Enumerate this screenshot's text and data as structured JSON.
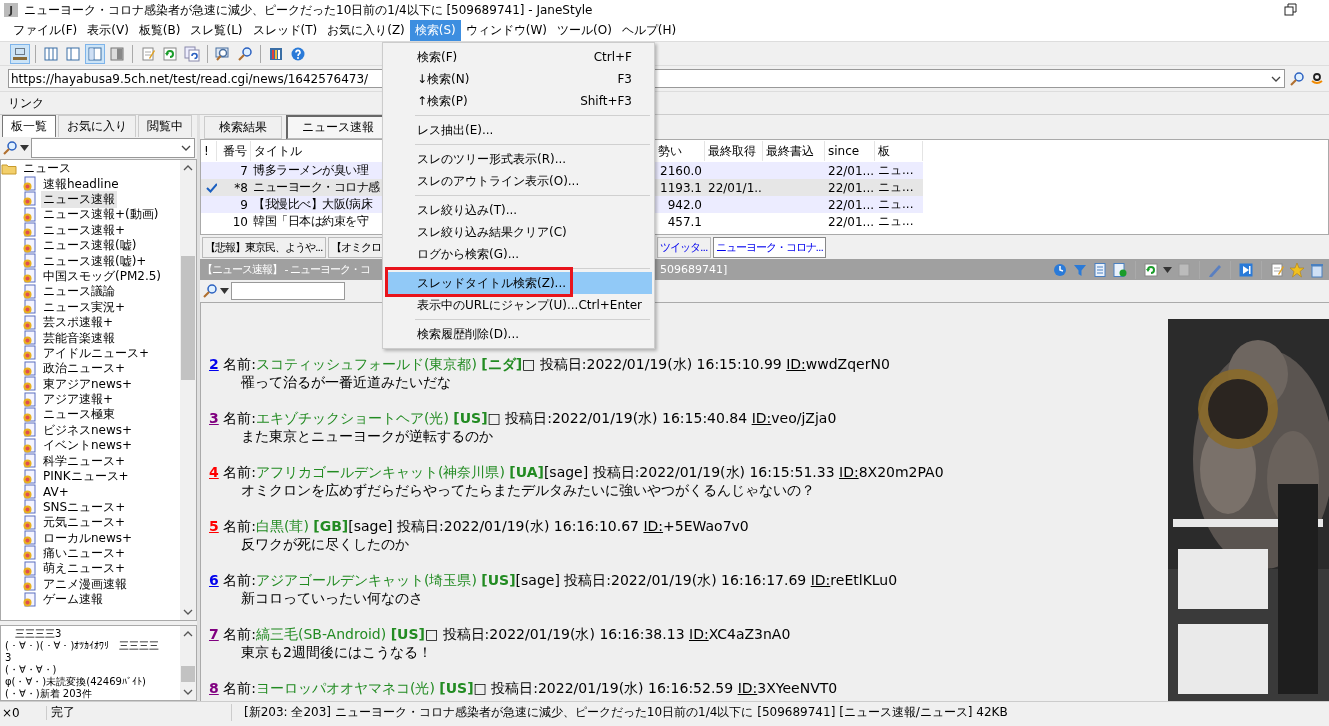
{
  "window": {
    "icon_letter": "J",
    "title": "ニューヨーク・コロナ感染者が急速に減少、ピークだった10日前の1/4以下に [509689741] - JaneStyle"
  },
  "menu_bar": [
    {
      "label": "ファイル(F)",
      "selected": false
    },
    {
      "label": "表示(V)",
      "selected": false
    },
    {
      "label": "板覧(B)",
      "selected": false
    },
    {
      "label": "スレ覧(L)",
      "selected": false
    },
    {
      "label": "スレッド(T)",
      "selected": false
    },
    {
      "label": "お気に入り(Z)",
      "selected": false
    },
    {
      "label": "検索(S)",
      "selected": true
    },
    {
      "label": "ウィンドウ(W)",
      "selected": false
    },
    {
      "label": "ツール(O)",
      "selected": false
    },
    {
      "label": "ヘルプ(H)",
      "selected": false
    }
  ],
  "toolbar": [
    {
      "kind": "network",
      "pressed": true
    },
    {
      "kind": "separator"
    },
    {
      "kind": "columns",
      "pressed": false
    },
    {
      "kind": "pane-left",
      "pressed": false
    },
    {
      "kind": "pane-right",
      "pressed": true
    },
    {
      "kind": "pane-gray",
      "pressed": false
    },
    {
      "kind": "separator"
    },
    {
      "kind": "notepad",
      "pressed": false
    },
    {
      "kind": "refresh",
      "pressed": false
    },
    {
      "kind": "refresh-all",
      "pressed": false
    },
    {
      "kind": "separator"
    },
    {
      "kind": "magnifier-page",
      "pressed": false
    },
    {
      "kind": "search",
      "pressed": false
    },
    {
      "kind": "separator"
    },
    {
      "kind": "tools",
      "pressed": false
    },
    {
      "kind": "help",
      "pressed": false
    }
  ],
  "address_bar": {
    "value": "https://hayabusa9.5ch.net/test/read.cgi/news/1642576473/"
  },
  "link_bar": {
    "label": "リンク"
  },
  "left_pane": {
    "tabs": [
      {
        "label": "板一覧",
        "selected": true
      },
      {
        "label": "お気に入り",
        "selected": false
      },
      {
        "label": "閲覧中",
        "selected": false
      }
    ],
    "tree": [
      {
        "label": "ニュース",
        "expanded": true,
        "children": [
          {
            "label": "速報headline",
            "selected": false
          },
          {
            "label": "ニュース速報",
            "selected": true
          },
          {
            "label": "ニュース速報+(動画)",
            "selected": false
          },
          {
            "label": "ニュース速報+",
            "selected": false
          },
          {
            "label": "ニュース速報(嘘)",
            "selected": false
          },
          {
            "label": "ニュース速報(嘘)+",
            "selected": false
          },
          {
            "label": "中国スモッグ(PM2.5)",
            "selected": false
          },
          {
            "label": "ニュース議論",
            "selected": false
          },
          {
            "label": "ニュース実況+",
            "selected": false
          },
          {
            "label": "芸スポ速報+",
            "selected": false
          },
          {
            "label": "芸能音楽速報",
            "selected": false
          },
          {
            "label": "アイドルニュース+",
            "selected": false
          },
          {
            "label": "政治ニュース+",
            "selected": false
          },
          {
            "label": "東アジアnews+",
            "selected": false
          },
          {
            "label": "アジア速報+",
            "selected": false
          },
          {
            "label": "ニュース極東",
            "selected": false
          },
          {
            "label": "ビジネスnews+",
            "selected": false
          },
          {
            "label": "イベントnews+",
            "selected": false
          },
          {
            "label": "科学ニュース+",
            "selected": false
          },
          {
            "label": "PINKニュース+",
            "selected": false
          },
          {
            "label": "AV+",
            "selected": false
          },
          {
            "label": "SNSニュース+",
            "selected": false
          },
          {
            "label": "元気ニュース+",
            "selected": false
          },
          {
            "label": "ローカルnews+",
            "selected": false
          },
          {
            "label": "痛いニュース+",
            "selected": false
          },
          {
            "label": "萌えニュース+",
            "selected": false
          },
          {
            "label": "アニメ漫画速報",
            "selected": false
          },
          {
            "label": "ゲーム速報",
            "selected": false
          }
        ]
      }
    ],
    "log": [
      "　三三三三3",
      "(・∀・)(・∀・)ｵﾂｶｲｵﾜﾘ　三三三三",
      "3",
      "(・∀・∀・)",
      "φ(・∀・)未読変換(42469ﾊﾞｲﾄ)",
      "(・∀・)新着 203件"
    ]
  },
  "right_pane": {
    "tabs": [
      {
        "label": "検索結果",
        "selected": false
      },
      {
        "label": "ニュース速報",
        "selected": true
      }
    ],
    "thread_list": {
      "columns": [
        "!",
        "番号",
        "タイトル",
        "勢い",
        "最終取得",
        "最終書込",
        "since",
        "板"
      ],
      "rows": [
        {
          "marked": false,
          "selected": false,
          "number": "7",
          "title": "博多ラーメンが臭い理",
          "momentum": "2160.0",
          "since": "22/01...",
          "board": "ニュ..."
        },
        {
          "marked": true,
          "selected": true,
          "number": "*8",
          "title": "ニューヨーク・コロナ感",
          "momentum": "1193.1",
          "last_fetched": "22/01/1...",
          "since": "22/01...",
          "board": "ニュ..."
        },
        {
          "marked": false,
          "selected": false,
          "number": "9",
          "title": "【我慢比べ】大阪(病床",
          "momentum": "942.0",
          "since": "22/01...",
          "board": "ニュ..."
        },
        {
          "marked": false,
          "selected": false,
          "number": "10",
          "title": "韓国「日本は約束を守",
          "momentum": "457.1",
          "since": "22/01...",
          "board": "ニュ..."
        }
      ]
    },
    "thread_tabs": [
      {
        "label": "【悲報】東京民、ようや...",
        "selected": false,
        "unread": false
      },
      {
        "label": "【オミクロ",
        "selected": false,
        "unread": false
      },
      {
        "label": "ツイッタ...",
        "selected": false,
        "unread": true
      },
      {
        "label": "ニューヨーク・コロナ...",
        "selected": true,
        "unread": true
      }
    ],
    "thread_header": {
      "board_part": "【ニュース速報】 - ニューヨーク・コ",
      "id_part": "509689741]"
    },
    "thread_toolbar": [
      {
        "kind": "clock"
      },
      {
        "kind": "filter"
      },
      {
        "kind": "page"
      },
      {
        "kind": "page-refresh"
      },
      {
        "kind": "separator"
      },
      {
        "kind": "refresh"
      },
      {
        "kind": "caret"
      },
      {
        "kind": "stop"
      },
      {
        "kind": "separator"
      },
      {
        "kind": "pen"
      },
      {
        "kind": "separator"
      },
      {
        "kind": "jump"
      },
      {
        "kind": "separator"
      },
      {
        "kind": "notepad"
      },
      {
        "kind": "star"
      },
      {
        "kind": "trash"
      }
    ],
    "posts": [
      {
        "number": "2",
        "color": "#0000ee",
        "name_label": "名前:",
        "name": "スコティッシュフォールド(東京都)",
        "tag": "[ニダ]",
        "mail": "□",
        "date": "投稿日:2022/01/19(水) 16:15:10.99",
        "id_label": "ID:",
        "id": "wwdZqerN0",
        "body": "罹って治るが一番近道みたいだな"
      },
      {
        "number": "3",
        "color": "#800080",
        "name_label": "名前:",
        "name": "エキゾチックショートヘア(光)",
        "tag": "[US]",
        "mail": "□",
        "date": "投稿日:2022/01/19(水) 16:15:40.84",
        "id_label": "ID:",
        "id": "veo/jZja0",
        "body": "また東京とニューヨークが逆転するのか"
      },
      {
        "number": "4",
        "color": "#ff0000",
        "name_label": "名前:",
        "name": "アフリカゴールデンキャット(神奈川県)",
        "tag": "[UA]",
        "mail": "[sage]",
        "date": "投稿日:2022/01/19(水) 16:15:51.33",
        "id_label": "ID:",
        "id": "8X20m2PA0",
        "body": "オミクロンを広めずだらだらやってたらまたデルタみたいに強いやつがくるんじゃないの？"
      },
      {
        "number": "5",
        "color": "#ff0000",
        "name_label": "名前:",
        "name": "白黒(茸)",
        "tag": "[GB]",
        "mail": "[sage]",
        "date": "投稿日:2022/01/19(水) 16:16:10.67",
        "id_label": "ID:",
        "id": "+5EWao7v0",
        "body": "反ワクが死に尽くしたのか"
      },
      {
        "number": "6",
        "color": "#0000ee",
        "name_label": "名前:",
        "name": "アジアゴールデンキャット(埼玉県)",
        "tag": "[US]",
        "mail": "[sage]",
        "date": "投稿日:2022/01/19(水) 16:16:17.69",
        "id_label": "ID:",
        "id": "reEtlKLu0",
        "body": "新コロっていったい何なのさ"
      },
      {
        "number": "7",
        "color": "#800080",
        "name_label": "名前:",
        "name": "縞三毛(SB-Android)",
        "tag": "[US]",
        "mail": "□",
        "date": "投稿日:2022/01/19(水) 16:16:38.13",
        "id_label": "ID:",
        "id": "XC4aZ3nA0",
        "body": "東京も2週間後にはこうなる！"
      },
      {
        "number": "8",
        "color": "#800080",
        "name_label": "名前:",
        "name": "ヨーロッパオオヤマネコ(光)",
        "tag": "[US]",
        "mail": "□",
        "date": "投稿日:2022/01/19(水) 16:16:52.59",
        "id_label": "ID:",
        "id": "3XYeeNVT0"
      }
    ]
  },
  "status_bar": {
    "count": "×0",
    "state": "完了",
    "info": "[新203: 全203] ニューヨーク・コロナ感染者が急速に減少、ピークだった10日前の1/4以下に [509689741] [ニュース速報/ニュース] 42KB"
  },
  "search_menu": {
    "items": [
      {
        "kind": "item",
        "label": "検索(F)",
        "shortcut": "Ctrl+F",
        "selected": false,
        "marked": false
      },
      {
        "kind": "item",
        "label": "↓検索(N)",
        "shortcut": "F3",
        "selected": false,
        "marked": false
      },
      {
        "kind": "item",
        "label": "↑検索(P)",
        "shortcut": "Shift+F3",
        "selected": false,
        "marked": false
      },
      {
        "kind": "separator"
      },
      {
        "kind": "item",
        "label": "レス抽出(E)...",
        "selected": false,
        "marked": false
      },
      {
        "kind": "separator"
      },
      {
        "kind": "item",
        "label": "スレのツリー形式表示(R)...",
        "selected": false,
        "marked": false
      },
      {
        "kind": "item",
        "label": "スレのアウトライン表示(O)...",
        "selected": false,
        "marked": false
      },
      {
        "kind": "separator"
      },
      {
        "kind": "item",
        "label": "スレ絞り込み(T)...",
        "selected": false,
        "marked": false
      },
      {
        "kind": "item",
        "label": "スレ絞り込み結果クリア(C)",
        "selected": false,
        "marked": false
      },
      {
        "kind": "item",
        "label": "ログから検索(G)...",
        "selected": false,
        "marked": false
      },
      {
        "kind": "separator"
      },
      {
        "kind": "item",
        "label": "スレッドタイトル検索(Z)...",
        "selected": true,
        "marked": true
      },
      {
        "kind": "item",
        "label": "表示中のURLにジャンプ(U)...",
        "shortcut": "Ctrl+Enter",
        "selected": false,
        "marked": false
      },
      {
        "kind": "separator"
      },
      {
        "kind": "item",
        "label": "検索履歴削除(D)...",
        "selected": false,
        "marked": false
      }
    ]
  }
}
